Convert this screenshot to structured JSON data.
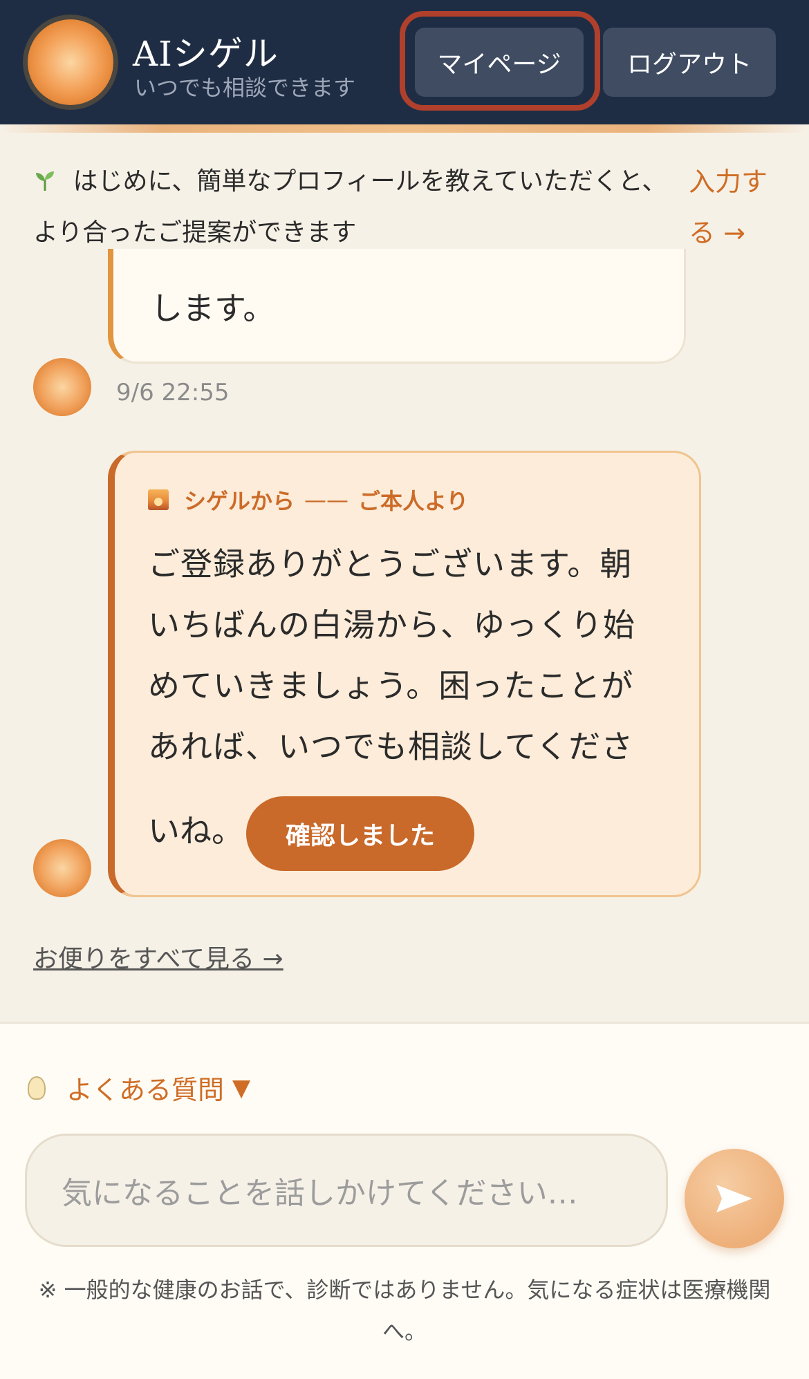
{
  "header": {
    "title": "AIシゲル",
    "subtitle": "いつでも相談できます",
    "mypage_label": "マイページ",
    "logout_label": "ログアウト"
  },
  "profile_banner": {
    "text": "はじめに、簡単なプロフィールを教えていただくと、より合ったご提案ができます",
    "link_label": "入力する →"
  },
  "chat": {
    "prev_message_tail": "します。",
    "prev_timestamp": "9/6 22:55",
    "letter": {
      "sender": "シゲルから",
      "separator": "——",
      "from_label": "ご本人より",
      "body": "ご登録ありがとうございます。朝いちばんの白湯から、ゆっくり始めていきましょう。困ったことがあれば、いつでも相談してくださ",
      "body_last": "いね。",
      "confirm_label": "確認しました"
    },
    "all_letters_link": "お便りをすべて見る →"
  },
  "composer": {
    "faq_label": "よくある質問",
    "faq_toggle": "▼",
    "input_placeholder": "気になることを話しかけてください…",
    "disclaimer": "※ 一般的な健康のお話で、診断ではありません。気になる症状は医療機関へ。"
  },
  "colors": {
    "header_bg": "#1f2d44",
    "accent": "#c9692a",
    "highlight_ring": "#b0402b",
    "page_bg": "#f6f1e7"
  }
}
